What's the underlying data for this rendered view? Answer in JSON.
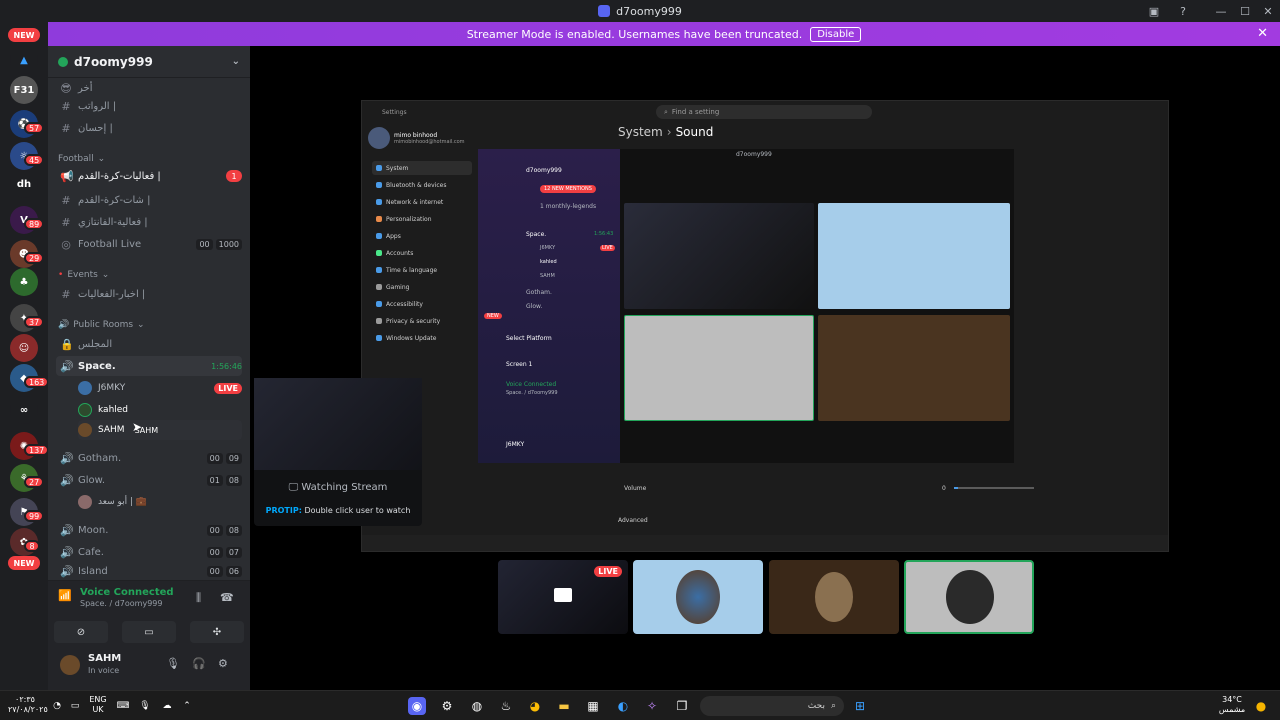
{
  "titlebar": {
    "title": "d7oomy999"
  },
  "banner": {
    "text": "Streamer Mode is enabled. Usernames have been truncated.",
    "disable_label": "Disable"
  },
  "rail": {
    "new_top": "NEW",
    "new_bottom": "NEW",
    "server_dh": "dh",
    "server_f31": "F31",
    "badges": [
      "57",
      "45",
      "89",
      "29",
      "37",
      "163",
      "37",
      "27",
      "99",
      "8",
      "137"
    ]
  },
  "server": {
    "name": "d7oomy999"
  },
  "channels": {
    "top_label": "أخر",
    "ch1": "الرواتب |",
    "ch2": "إحسان |",
    "cat_football": "Football",
    "ch3": "فعاليات-كرة-القدم |",
    "ch3_badge": "1",
    "ch4": "شات-كرة-القدم |",
    "ch5": "فعالية-الفانتازي |",
    "ch6": "Football Live",
    "ch6_a": "00",
    "ch6_b": "1000",
    "cat_events": "Events",
    "ch7": "اخبار-الفعاليات |",
    "cat_public": "Public Rooms",
    "ch8": "المجلس",
    "ch9": "Space.",
    "ch9_time": "1:56:46",
    "m1": "J6MKY",
    "m1_tag": "LIVE",
    "m2": "kahled",
    "m3": "SAHM",
    "m3_hover": "SAHM",
    "ch10": "Gotham.",
    "ch10_a": "00",
    "ch10_b": "09",
    "ch11": "Glow.",
    "ch11_a": "01",
    "ch11_b": "08",
    "m4": "أبو سعد | 💼",
    "ch12": "Moon.",
    "ch12_a": "00",
    "ch12_b": "08",
    "ch13": "Cafe.",
    "ch13_a": "00",
    "ch13_b": "07",
    "ch14": "Island",
    "ch14_a": "00",
    "ch14_b": "06"
  },
  "voice": {
    "title": "Voice Connected",
    "sub": "Space. / d7oomy999"
  },
  "user": {
    "name": "SAHM",
    "status": "In voice"
  },
  "hover_card": {
    "watching": "Watching Stream",
    "protip_label": "PROTIP:",
    "protip_text": "Double click user to watch"
  },
  "settings_window": {
    "app": "Settings",
    "search": "Find a setting",
    "account_name": "mimo binhood",
    "account_email": "mimobinhood@hotmail.com",
    "crumb_parent": "System",
    "crumb_child": "Sound",
    "nav": [
      "System",
      "Bluetooth & devices",
      "Network & internet",
      "Personalization",
      "Apps",
      "Accounts",
      "Time & language",
      "Gaming",
      "Accessibility",
      "Privacy & security",
      "Windows Update"
    ],
    "volume": "Volume",
    "volume_value": "0",
    "advanced": "Advanced"
  },
  "inner_discord": {
    "server": "d7oomy999",
    "mentions": "12 NEW MENTIONS",
    "legends": "1 monthly-legends",
    "space": "Space.",
    "space_time": "1:56:43",
    "m1": "J6MKY",
    "m2": "kahled",
    "m3": "SAHM",
    "gotham": "Gotham.",
    "glow": "Glow.",
    "select_platform": "Select Platform",
    "screen": "Screen 1",
    "voice_connected": "Voice Connected",
    "voice_sub": "Space. / d7oomy999",
    "user": "J6MKY",
    "live": "LIVE",
    "new": "NEW",
    "title": "d7oomy999"
  },
  "bottom_tiles": {
    "live": "LIVE"
  },
  "taskbar": {
    "time_left": "٠٢:٣٥",
    "date_left": "٢٧/٠٨/٢٠٢٥",
    "lang": "ENG",
    "lang2": "UK",
    "search_placeholder": "بحث",
    "weather_temp": "34°C",
    "weather_desc": "مشمس"
  }
}
